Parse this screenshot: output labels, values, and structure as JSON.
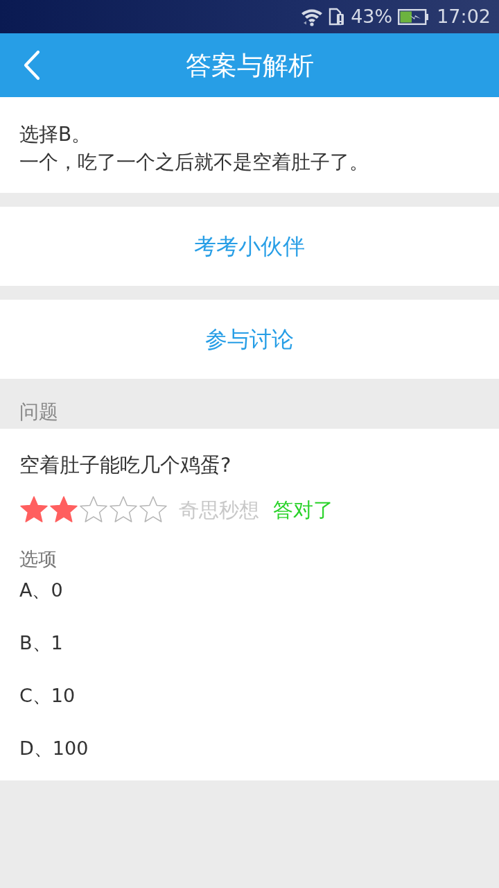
{
  "status_bar": {
    "battery": "43%",
    "time": "17:02"
  },
  "app_bar": {
    "title": "答案与解析"
  },
  "answer": {
    "lines": [
      "选择B。",
      "一个，吃了一个之后就不是空着肚子了。"
    ]
  },
  "actions": [
    "考考小伙伴",
    "参与讨论"
  ],
  "question": {
    "section_label": "问题",
    "text": "空着肚子能吃几个鸡蛋?",
    "stars": 2,
    "difficulty": "奇思秒想",
    "result": "答对了",
    "correct": true,
    "options_label": "选项",
    "options": [
      "A、0",
      "B、1",
      "C、10",
      "D、100"
    ]
  }
}
